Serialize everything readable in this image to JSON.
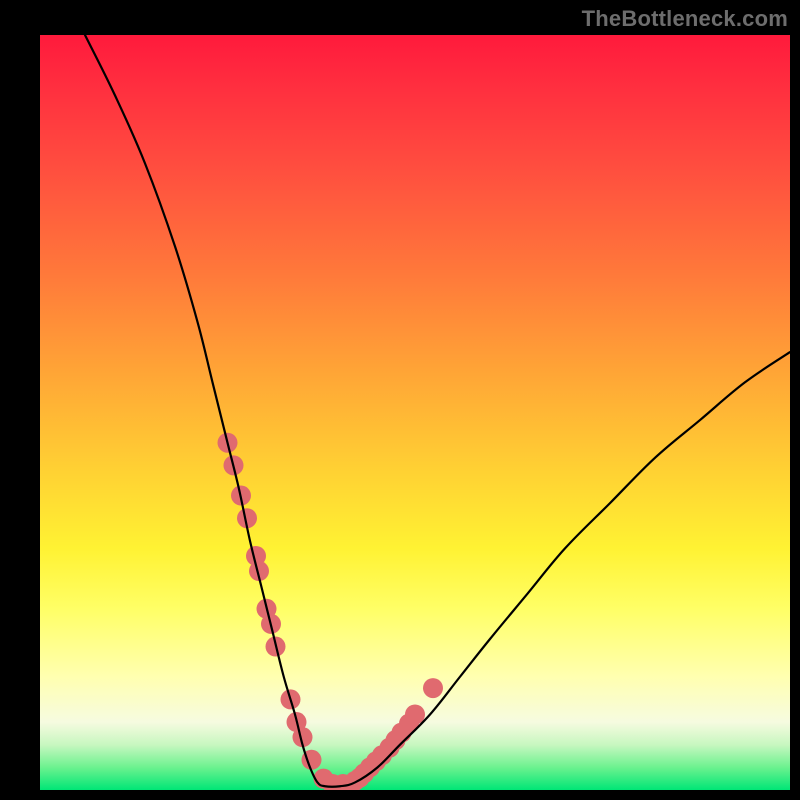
{
  "watermark": "TheBottleneck.com",
  "chart_data": {
    "type": "line",
    "title": "",
    "xlabel": "",
    "ylabel": "",
    "xlim": [
      0,
      100
    ],
    "ylim": [
      0,
      100
    ],
    "series": [
      {
        "name": "bottleneck-curve",
        "x": [
          6,
          10,
          14,
          18,
          21,
          23,
          25,
          26.5,
          28,
          29.5,
          31,
          32.5,
          34,
          35,
          36,
          37,
          38,
          40,
          42,
          45,
          48,
          52,
          56,
          60,
          65,
          70,
          76,
          82,
          88,
          94,
          100
        ],
        "y": [
          100,
          92,
          83,
          72,
          62,
          54,
          46,
          40,
          33,
          27,
          21,
          15,
          10,
          6,
          3,
          1,
          0.5,
          0.5,
          1,
          3,
          6,
          10,
          15,
          20,
          26,
          32,
          38,
          44,
          49,
          54,
          58
        ]
      }
    ],
    "markers": {
      "name": "highlight-dots",
      "x": [
        25,
        25.8,
        26.8,
        27.6,
        28.8,
        29.2,
        30.2,
        30.8,
        31.4,
        33.4,
        34.2,
        35.0,
        36.2,
        37.8,
        39.0,
        40.4,
        42.0,
        42.6,
        43.2,
        44.0,
        44.8,
        45.6,
        46.6,
        47.4,
        48.2,
        49.2,
        50.0,
        52.4
      ],
      "y": [
        46,
        43,
        39,
        36,
        31,
        29,
        24,
        22,
        19,
        12,
        9,
        7,
        4,
        1.5,
        0.8,
        0.8,
        1.2,
        1.6,
        2.2,
        3.0,
        3.8,
        4.6,
        5.6,
        6.6,
        7.6,
        8.8,
        10.0,
        13.5
      ],
      "color": "#e06a6f",
      "radius": 10
    },
    "curve_color": "#000000",
    "curve_width": 2.2
  }
}
